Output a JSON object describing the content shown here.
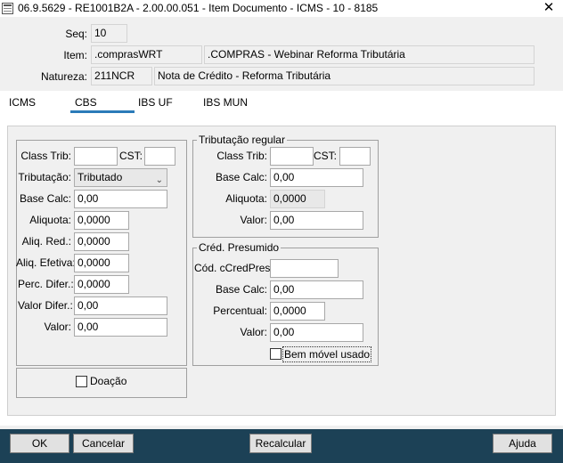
{
  "window": {
    "title": "06.9.5629 - RE1001B2A - 2.00.00.051 - Item Documento - ICMS - 10 - 8185",
    "close_label": "✕"
  },
  "header": {
    "seq_label": "Seq:",
    "seq_value": "10",
    "item_label": "Item:",
    "item_code": ".comprasWRT",
    "item_desc": ".COMPRAS - Webinar Reforma Tributária",
    "natureza_label": "Natureza:",
    "natureza_code": "211NCR",
    "natureza_desc": "Nota de Crédito - Reforma Tributária"
  },
  "tabs": [
    "ICMS",
    "CBS",
    "IBS UF",
    "IBS MUN"
  ],
  "active_tab": "CBS",
  "left": {
    "class_trib_label": "Class Trib:",
    "class_trib_value": "",
    "cst_label": "CST:",
    "cst_value": "",
    "tributacao_label": "Tributação:",
    "tributacao_value": "Tributado",
    "base_calc_label": "Base Calc:",
    "base_calc_value": "0,00",
    "aliquota_label": "Aliquota:",
    "aliquota_value": "0,0000",
    "aliq_red_label": "Aliq. Red.:",
    "aliq_red_value": "0,0000",
    "aliq_efetiva_label": "Aliq. Efetiva:",
    "aliq_efetiva_value": "0,0000",
    "perc_difer_label": "Perc. Difer.:",
    "perc_difer_value": "0,0000",
    "valor_difer_label": "Valor Difer.:",
    "valor_difer_value": "0,00",
    "valor_label": "Valor:",
    "valor_value": "0,00",
    "doacao_label": "Doação",
    "doacao_checked": false
  },
  "regular": {
    "legend": "Tributação regular",
    "class_trib_label": "Class Trib:",
    "class_trib_value": "",
    "cst_label": "CST:",
    "cst_value": "",
    "base_calc_label": "Base Calc:",
    "base_calc_value": "0,00",
    "aliquota_label": "Aliquota:",
    "aliquota_value": "0,0000",
    "valor_label": "Valor:",
    "valor_value": "0,00"
  },
  "presumido": {
    "legend": "Créd. Presumido",
    "ccredpres_label": "Cód. cCredPres:",
    "ccredpres_value": "",
    "base_calc_label": "Base Calc:",
    "base_calc_value": "0,00",
    "percentual_label": "Percentual:",
    "percentual_value": "0,0000",
    "valor_label": "Valor:",
    "valor_value": "0,00",
    "bem_movel_label": "Bem móvel usado",
    "bem_movel_checked": false
  },
  "footer": {
    "ok_label": "OK",
    "cancelar_label": "Cancelar",
    "recalcular_label": "Recalcular",
    "ajuda_label": "Ajuda"
  }
}
